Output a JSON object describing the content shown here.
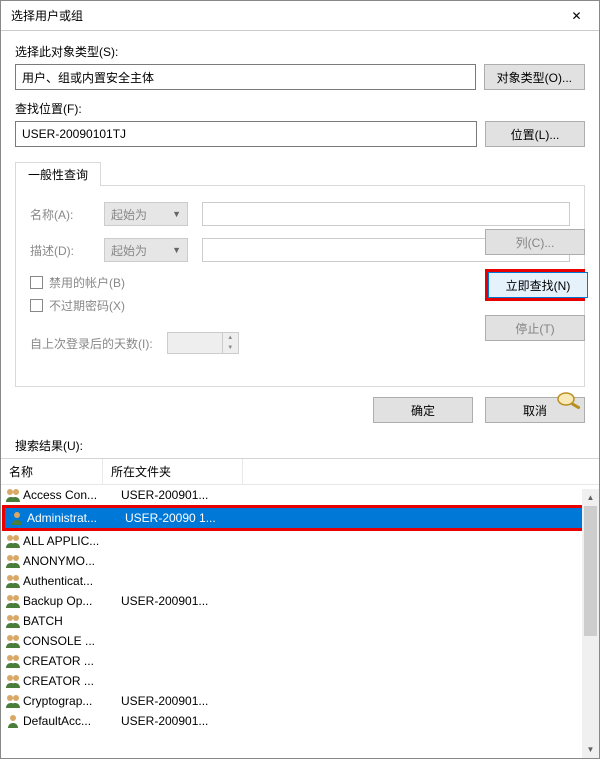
{
  "window": {
    "title": "选择用户或组",
    "close": "✕"
  },
  "sec1": {
    "label": "选择此对象类型(S):",
    "value": "用户、组或内置安全主体",
    "btn": "对象类型(O)..."
  },
  "sec2": {
    "label": "查找位置(F):",
    "value": "USER-20090101TJ",
    "btn": "位置(L)..."
  },
  "tab": {
    "label": "一般性查询"
  },
  "form": {
    "nameLabel": "名称(A):",
    "nameOp": "起始为",
    "descLabel": "描述(D):",
    "descOp": "起始为",
    "chk1": "禁用的帐户(B)",
    "chk2": "不过期密码(X)",
    "daysLabel": "自上次登录后的天数(I):"
  },
  "right": {
    "cols": "列(C)...",
    "findNow": "立即查找(N)",
    "stop": "停止(T)"
  },
  "actions": {
    "ok": "确定",
    "cancel": "取消"
  },
  "resultsLabel": "搜索结果(U):",
  "headers": {
    "name": "名称",
    "folder": "所在文件夹"
  },
  "rows": [
    {
      "icon": "group",
      "name": "Access Con...",
      "folder": "USER-200901..."
    },
    {
      "icon": "user",
      "name": "Administrat...",
      "folder": "USER-20090 1...",
      "selected": true,
      "highlighted": true
    },
    {
      "icon": "group",
      "name": "ALL APPLIC...",
      "folder": ""
    },
    {
      "icon": "group",
      "name": "ANONYMO...",
      "folder": ""
    },
    {
      "icon": "group",
      "name": "Authenticat...",
      "folder": ""
    },
    {
      "icon": "group",
      "name": "Backup Op...",
      "folder": "USER-200901..."
    },
    {
      "icon": "group",
      "name": "BATCH",
      "folder": ""
    },
    {
      "icon": "group",
      "name": "CONSOLE ...",
      "folder": ""
    },
    {
      "icon": "group",
      "name": "CREATOR ...",
      "folder": ""
    },
    {
      "icon": "group",
      "name": "CREATOR ...",
      "folder": ""
    },
    {
      "icon": "group",
      "name": "Cryptograp...",
      "folder": "USER-200901..."
    },
    {
      "icon": "user",
      "name": "DefaultAcc...",
      "folder": "USER-200901..."
    }
  ]
}
